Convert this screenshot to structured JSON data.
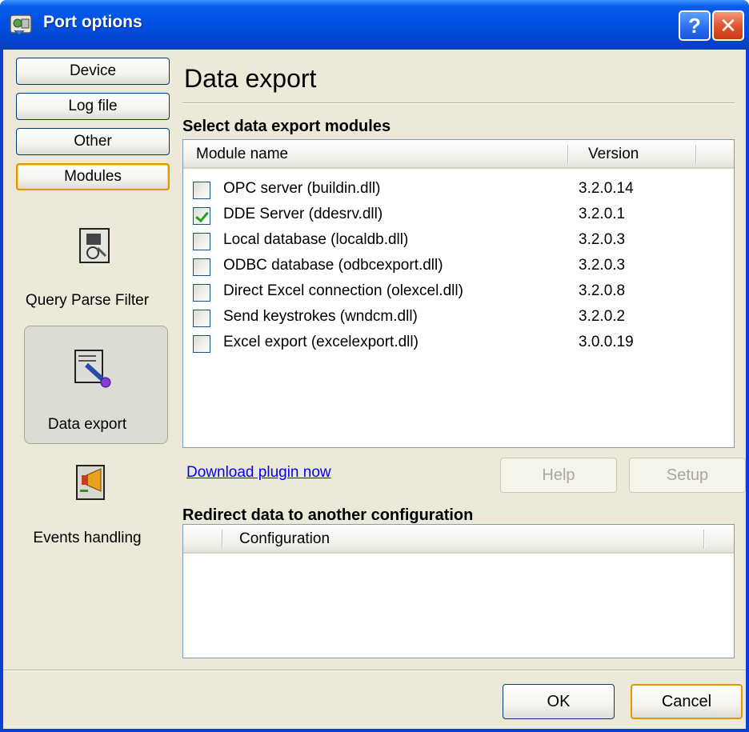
{
  "window": {
    "title": "Port options",
    "help_glyph": "?",
    "close_glyph": "✕"
  },
  "nav": {
    "tabs": [
      "Device",
      "Log file",
      "Other",
      "Modules"
    ],
    "active_tab": "Modules",
    "items": [
      {
        "label": "Query Parse Filter",
        "icon": "query-parse-filter-icon"
      },
      {
        "label": "Data export",
        "icon": "data-export-icon",
        "selected": true
      },
      {
        "label": "Events handling",
        "icon": "events-handling-icon"
      }
    ]
  },
  "main": {
    "title": "Data export",
    "modules_heading": "Select data export modules",
    "columns": {
      "name": "Module name",
      "version": "Version"
    },
    "modules": [
      {
        "name": "OPC server (buildin.dll)",
        "version": "3.2.0.14",
        "checked": false
      },
      {
        "name": "DDE Server (ddesrv.dll)",
        "version": "3.2.0.1",
        "checked": true
      },
      {
        "name": "Local database (localdb.dll)",
        "version": "3.2.0.3",
        "checked": false
      },
      {
        "name": "ODBC database (odbcexport.dll)",
        "version": "3.2.0.3",
        "checked": false
      },
      {
        "name": "Direct Excel connection (olexcel.dll)",
        "version": "3.2.0.8",
        "checked": false
      },
      {
        "name": "Send keystrokes (wndcm.dll)",
        "version": "3.2.0.2",
        "checked": false
      },
      {
        "name": "Excel export (excelexport.dll)",
        "version": "3.0.0.19",
        "checked": false
      }
    ],
    "download_link": "Download plugin now",
    "help_button": "Help",
    "setup_button": "Setup",
    "redirect_heading": "Redirect data to another configuration",
    "config_column": "Configuration"
  },
  "footer": {
    "ok_button": "OK",
    "cancel_button": "Cancel"
  },
  "colors": {
    "titlebar": "#0052e5",
    "accent_orange": "#e59700",
    "link": "#0000ff"
  }
}
